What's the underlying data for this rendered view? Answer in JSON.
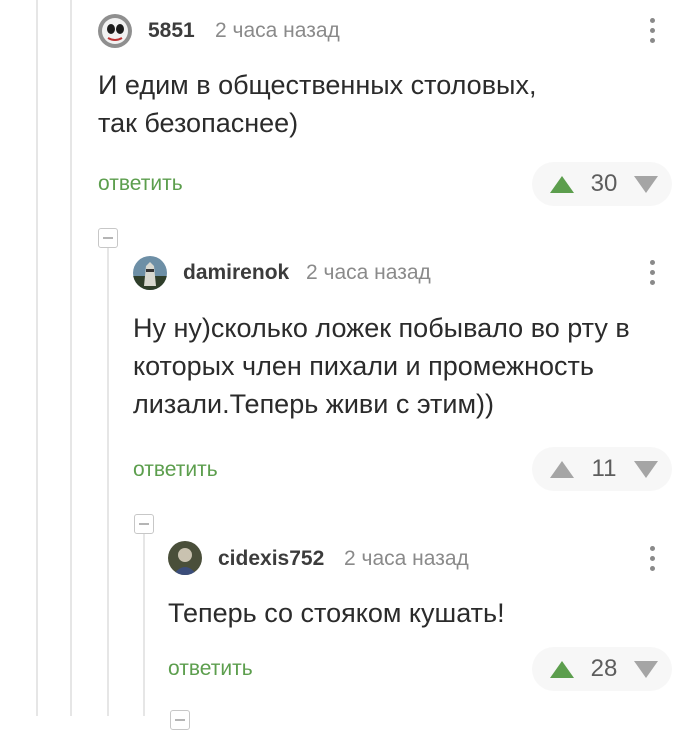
{
  "colors": {
    "accent_green": "#5c9e4d",
    "username": "#3c3c3c",
    "muted": "#8a8a8a",
    "thread_line": "#e6e6e6"
  },
  "comments": [
    {
      "username": "5851",
      "time": "2 часа назад",
      "text_lines": [
        "И едим в общественных столовых,",
        "так безопаснее)"
      ],
      "reply_label": "ответить",
      "score": "30",
      "upvoted": true,
      "avatar_icon": "user-avatar-icon"
    },
    {
      "username": "damirenok",
      "time": "2 часа назад",
      "text_lines": [
        "Ну ну)сколько ложек побывало во рту в",
        "которых член пихали и промежность",
        "лизали.Теперь живи с этим))"
      ],
      "reply_label": "ответить",
      "score": "11",
      "upvoted": false,
      "avatar_icon": "user-avatar-icon"
    },
    {
      "username": "cidexis752",
      "time": "2 часа назад",
      "text_lines": [
        "Теперь со стояком кушать!"
      ],
      "reply_label": "ответить",
      "score": "28",
      "upvoted": true,
      "avatar_icon": "user-avatar-icon"
    }
  ]
}
